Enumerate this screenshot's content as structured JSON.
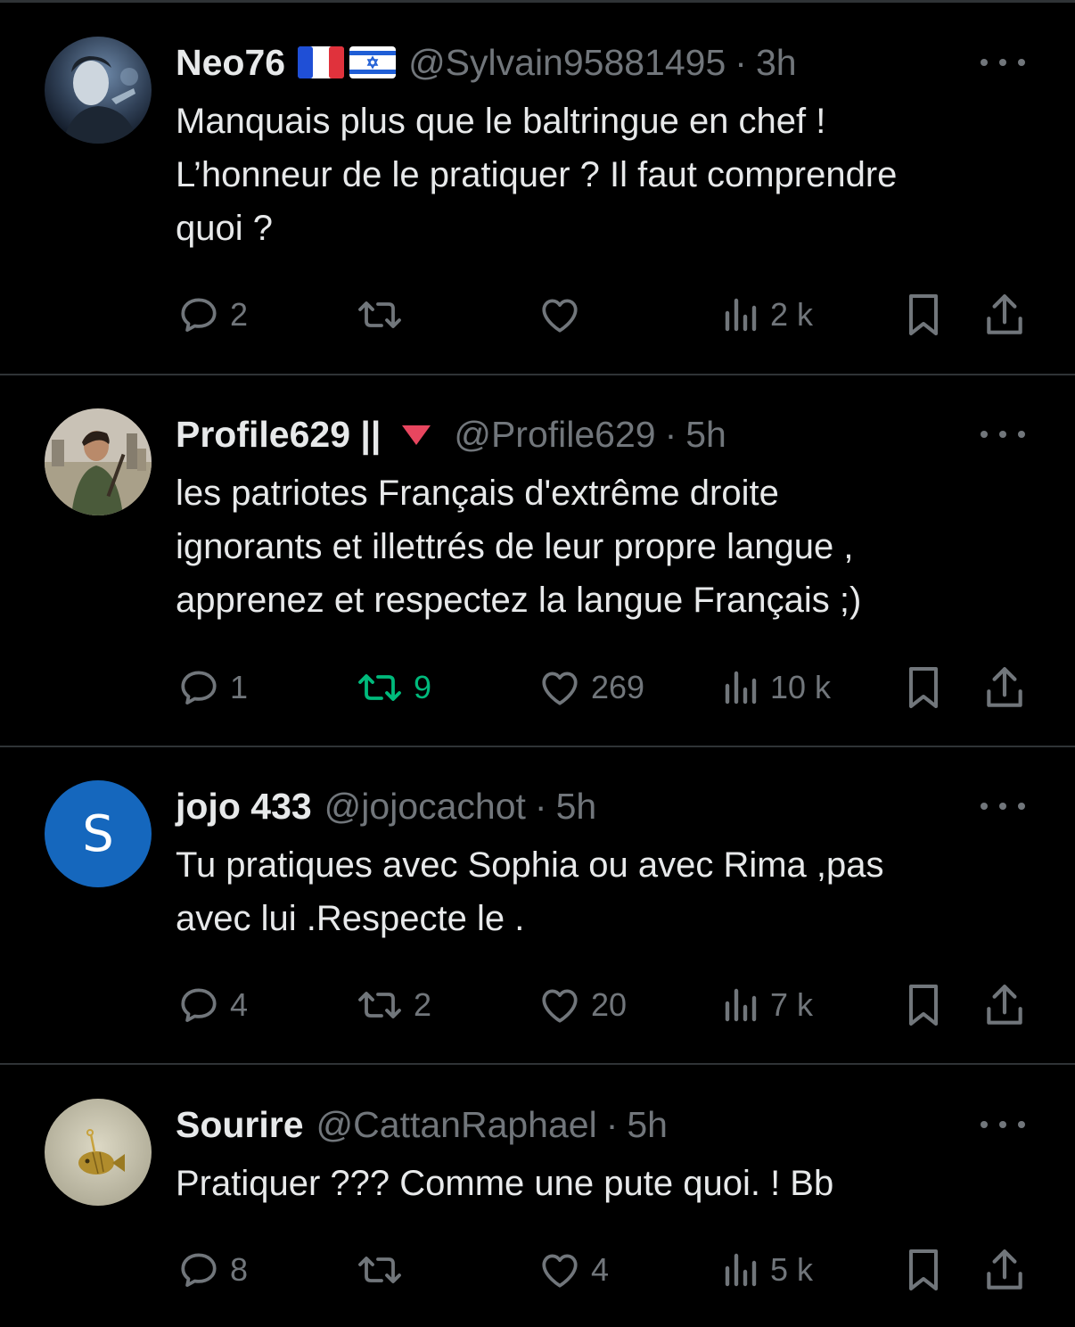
{
  "colors": {
    "background": "#000000",
    "text": "#e7e9ea",
    "muted": "#71767b",
    "divider": "#2f3336",
    "retweeted": "#00ba7c"
  },
  "tweets": [
    {
      "name": "Neo76",
      "badges": [
        "france-flag-icon",
        "israel-flag-icon"
      ],
      "handle": "@Sylvain95881495",
      "separator": "·",
      "time": "3h",
      "text": "Manquais plus que le baltringue en chef !\nL’honneur de le pratiquer ? Il faut comprendre\nquoi ?",
      "replies": "2",
      "retweets": "",
      "likes": "",
      "views": "2 k",
      "retweeted": false
    },
    {
      "name": "Profile629 ||",
      "badges": [
        "red-triangle-icon"
      ],
      "handle": "@Profile629",
      "separator": "·",
      "time": "5h",
      "text": "les patriotes Français d'extrême droite\nignorants et illettrés de leur propre langue ,\napprenez et respectez la langue Français ;)",
      "replies": "1",
      "retweets": "9",
      "likes": "269",
      "views": "10 k",
      "retweeted": true
    },
    {
      "name": "jojo 433",
      "avatar_letter": "S",
      "handle": "@jojocachot",
      "separator": "·",
      "time": "5h",
      "text": "Tu pratiques avec Sophia ou avec Rima ,pas\navec lui .Respecte le .",
      "replies": "4",
      "retweets": "2",
      "likes": "20",
      "views": "7 k",
      "retweeted": false
    },
    {
      "name": "Sourire",
      "handle": "@CattanRaphael",
      "separator": "·",
      "time": "5h",
      "text": "Pratiquer ??? Comme une pute quoi. ! Bb",
      "replies": "8",
      "retweets": "",
      "likes": "4",
      "views": "5 k",
      "retweeted": false
    }
  ]
}
